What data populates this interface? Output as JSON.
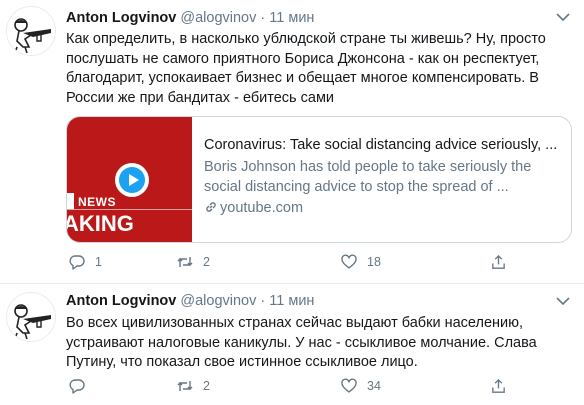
{
  "tweets": [
    {
      "author_name": "Anton Logvinov",
      "handle": "@alogvinov",
      "separator": "·",
      "time": "11 мин",
      "text": "Как определить, в насколько ублюдской стране ты живешь? Ну, просто послушать не самого приятного Бориса Джонсона - как он респектует, благодарит, успокаивает бизнес и обещает многое компенсировать. В России же при бандитах - ебитесь сами",
      "card": {
        "thumb_label_top": "NEWS",
        "thumb_label_bottom": "AKING",
        "title": "Coronavirus: Take social distancing advice seriously, ...",
        "description": "Boris Johnson has told people to take seriously the social distancing advice to stop the spread of ...",
        "domain": "youtube.com"
      },
      "replies": "1",
      "retweets": "2",
      "likes": "18"
    },
    {
      "author_name": "Anton Logvinov",
      "handle": "@alogvinov",
      "separator": "·",
      "time": "11 мин",
      "text": "Во всех цивилизованных странах сейчас выдают бабки населению, устраивают налоговые каникулы. У нас - ссыкливое молчание. Слава Путину, что показал свое истинное ссыкливое лицо.",
      "replies": "",
      "retweets": "2",
      "likes": "34"
    }
  ],
  "colors": {
    "secondary_text": "#657786",
    "accent": "#1da1f2",
    "bbc_red": "#bb1919",
    "border": "#e6ecf0"
  },
  "icons": {
    "avatar": "soldier-with-gun-avatar",
    "caret": "chevron-down-icon",
    "reply": "reply-icon",
    "retweet": "retweet-icon",
    "like": "heart-icon",
    "share": "share-icon",
    "link": "link-icon",
    "play": "play-icon"
  }
}
